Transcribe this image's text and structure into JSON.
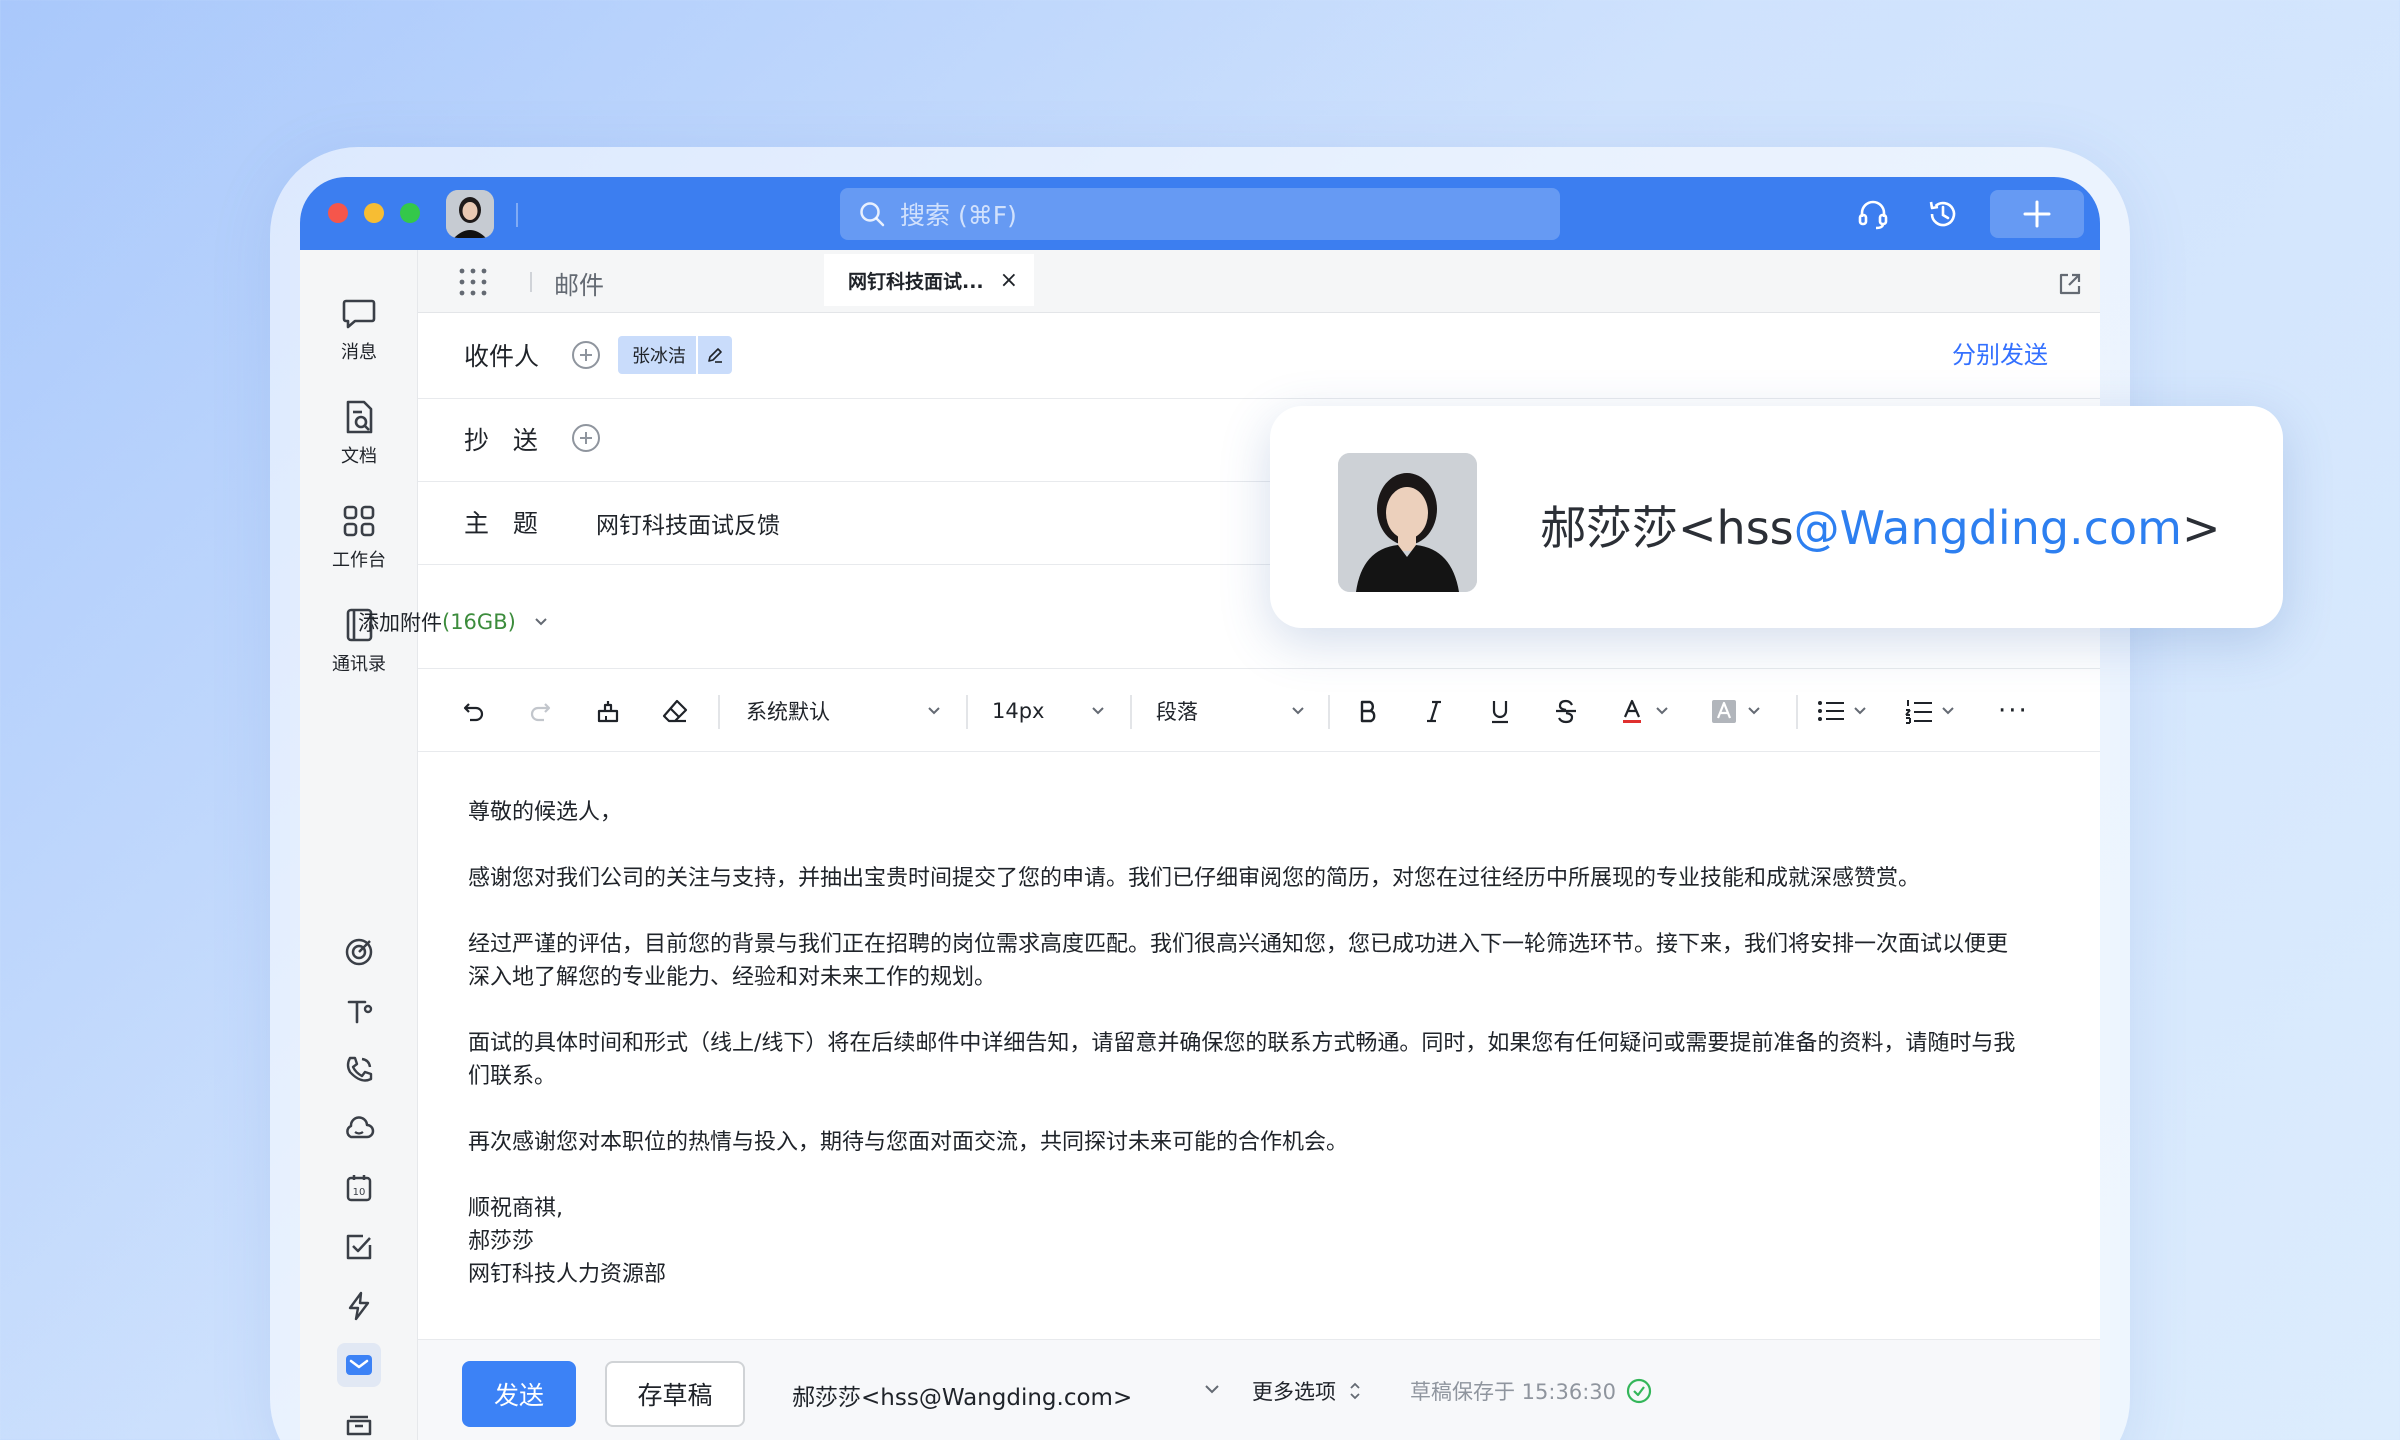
{
  "titlebar": {
    "search_placeholder": "搜索 (⌘F)",
    "accent": "#3c7ef0"
  },
  "sidebar": {
    "items": [
      {
        "label": "消息",
        "icon": "chat-bubble-icon"
      },
      {
        "label": "文档",
        "icon": "document-icon"
      },
      {
        "label": "工作台",
        "icon": "workspace-grid-icon"
      },
      {
        "label": "通讯录",
        "icon": "contacts-book-icon"
      }
    ],
    "more": "···"
  },
  "tabs": {
    "section_label": "邮件",
    "active_tab": "网钉科技面试...",
    "close_glyph": "×"
  },
  "compose": {
    "to_label": "收件人",
    "recipient_chip": "张冰洁",
    "send_separately": "分别发送",
    "cc_label": "抄   送",
    "subject_label": "主   题",
    "subject_value": "网钉科技面试反馈",
    "attach_label": "添加附件",
    "attach_size": "(16GB)"
  },
  "toolbar": {
    "font_family": "系统默认",
    "font_size": "14px",
    "paragraph": "段落",
    "more": "···"
  },
  "body": {
    "greeting": "尊敬的候选人，",
    "p1": "感谢您对我们公司的关注与支持，并抽出宝贵时间提交了您的申请。我们已仔细审阅您的简历，对您在过往经历中所展现的专业技能和成就深感赞赏。",
    "p2": "经过严谨的评估，目前您的背景与我们正在招聘的岗位需求高度匹配。我们很高兴通知您，您已成功进入下一轮筛选环节。接下来，我们将安排一次面试以便更深入地了解您的专业能力、经验和对未来工作的规划。",
    "p3": "面试的具体时间和形式（线上/线下）将在后续邮件中详细告知，请留意并确保您的联系方式畅通。同时，如果您有任何疑问或需要提前准备的资料，请随时与我们联系。",
    "p4": "再次感谢您对本职位的热情与投入，期待与您面对面交流，共同探讨未来可能的合作机会。",
    "closing": "顺祝商祺,",
    "signer": "郝莎莎",
    "department": "网钉科技人力资源部"
  },
  "footer": {
    "send": "发送",
    "save_draft": "存草稿",
    "from": "郝莎莎<hss@Wangding.com>",
    "more_options": "更多选项",
    "draft_saved": "草稿保存于 15:36:30"
  },
  "card": {
    "name_prefix": "郝莎莎<hss",
    "email_highlight": "@Wangding.com",
    "name_suffix": ">"
  }
}
